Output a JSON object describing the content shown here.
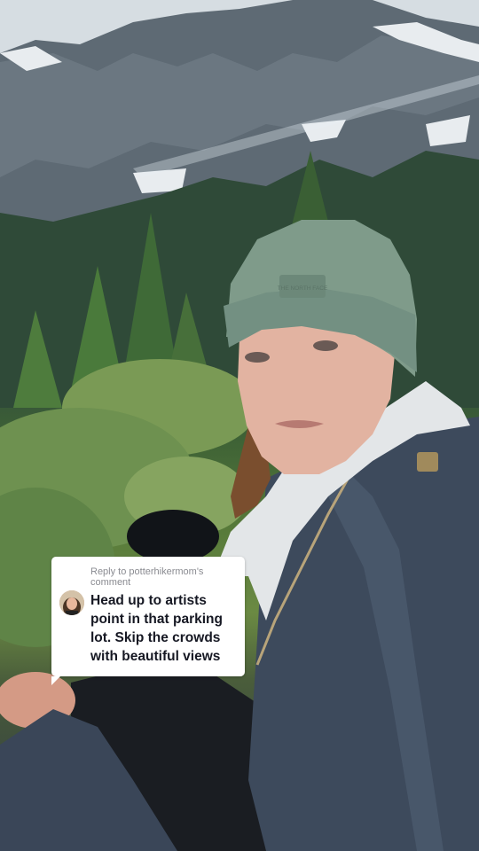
{
  "reply_card": {
    "header": "Reply to potterhikermom's comment",
    "comment": "Head up to artists point in that parking lot. Skip the crowds with beautiful views"
  },
  "beanie_logo": "THE NORTH FACE",
  "colors": {
    "card_background": "#ffffff",
    "header_text": "#8a8b91",
    "comment_text": "#161823",
    "beanie": "#7f9b8a",
    "jacket": "#3d4a5c"
  }
}
